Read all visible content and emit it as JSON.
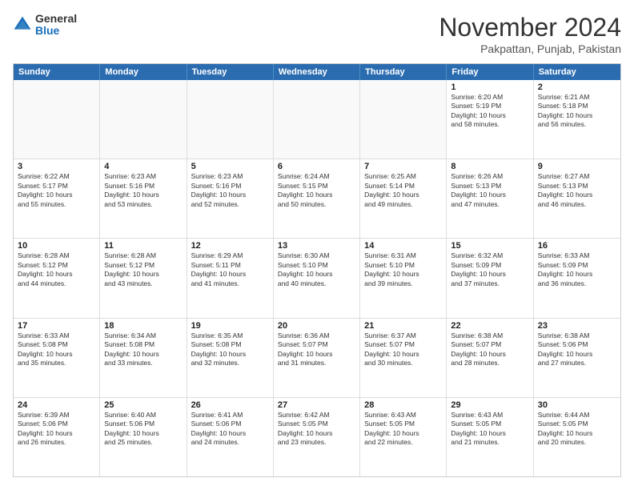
{
  "logo": {
    "general": "General",
    "blue": "Blue"
  },
  "title": "November 2024",
  "subtitle": "Pakpattan, Punjab, Pakistan",
  "days": [
    "Sunday",
    "Monday",
    "Tuesday",
    "Wednesday",
    "Thursday",
    "Friday",
    "Saturday"
  ],
  "weeks": [
    [
      {
        "day": "",
        "content": ""
      },
      {
        "day": "",
        "content": ""
      },
      {
        "day": "",
        "content": ""
      },
      {
        "day": "",
        "content": ""
      },
      {
        "day": "",
        "content": ""
      },
      {
        "day": "1",
        "content": "Sunrise: 6:20 AM\nSunset: 5:19 PM\nDaylight: 10 hours\nand 58 minutes."
      },
      {
        "day": "2",
        "content": "Sunrise: 6:21 AM\nSunset: 5:18 PM\nDaylight: 10 hours\nand 56 minutes."
      }
    ],
    [
      {
        "day": "3",
        "content": "Sunrise: 6:22 AM\nSunset: 5:17 PM\nDaylight: 10 hours\nand 55 minutes."
      },
      {
        "day": "4",
        "content": "Sunrise: 6:23 AM\nSunset: 5:16 PM\nDaylight: 10 hours\nand 53 minutes."
      },
      {
        "day": "5",
        "content": "Sunrise: 6:23 AM\nSunset: 5:16 PM\nDaylight: 10 hours\nand 52 minutes."
      },
      {
        "day": "6",
        "content": "Sunrise: 6:24 AM\nSunset: 5:15 PM\nDaylight: 10 hours\nand 50 minutes."
      },
      {
        "day": "7",
        "content": "Sunrise: 6:25 AM\nSunset: 5:14 PM\nDaylight: 10 hours\nand 49 minutes."
      },
      {
        "day": "8",
        "content": "Sunrise: 6:26 AM\nSunset: 5:13 PM\nDaylight: 10 hours\nand 47 minutes."
      },
      {
        "day": "9",
        "content": "Sunrise: 6:27 AM\nSunset: 5:13 PM\nDaylight: 10 hours\nand 46 minutes."
      }
    ],
    [
      {
        "day": "10",
        "content": "Sunrise: 6:28 AM\nSunset: 5:12 PM\nDaylight: 10 hours\nand 44 minutes."
      },
      {
        "day": "11",
        "content": "Sunrise: 6:28 AM\nSunset: 5:12 PM\nDaylight: 10 hours\nand 43 minutes."
      },
      {
        "day": "12",
        "content": "Sunrise: 6:29 AM\nSunset: 5:11 PM\nDaylight: 10 hours\nand 41 minutes."
      },
      {
        "day": "13",
        "content": "Sunrise: 6:30 AM\nSunset: 5:10 PM\nDaylight: 10 hours\nand 40 minutes."
      },
      {
        "day": "14",
        "content": "Sunrise: 6:31 AM\nSunset: 5:10 PM\nDaylight: 10 hours\nand 39 minutes."
      },
      {
        "day": "15",
        "content": "Sunrise: 6:32 AM\nSunset: 5:09 PM\nDaylight: 10 hours\nand 37 minutes."
      },
      {
        "day": "16",
        "content": "Sunrise: 6:33 AM\nSunset: 5:09 PM\nDaylight: 10 hours\nand 36 minutes."
      }
    ],
    [
      {
        "day": "17",
        "content": "Sunrise: 6:33 AM\nSunset: 5:08 PM\nDaylight: 10 hours\nand 35 minutes."
      },
      {
        "day": "18",
        "content": "Sunrise: 6:34 AM\nSunset: 5:08 PM\nDaylight: 10 hours\nand 33 minutes."
      },
      {
        "day": "19",
        "content": "Sunrise: 6:35 AM\nSunset: 5:08 PM\nDaylight: 10 hours\nand 32 minutes."
      },
      {
        "day": "20",
        "content": "Sunrise: 6:36 AM\nSunset: 5:07 PM\nDaylight: 10 hours\nand 31 minutes."
      },
      {
        "day": "21",
        "content": "Sunrise: 6:37 AM\nSunset: 5:07 PM\nDaylight: 10 hours\nand 30 minutes."
      },
      {
        "day": "22",
        "content": "Sunrise: 6:38 AM\nSunset: 5:07 PM\nDaylight: 10 hours\nand 28 minutes."
      },
      {
        "day": "23",
        "content": "Sunrise: 6:38 AM\nSunset: 5:06 PM\nDaylight: 10 hours\nand 27 minutes."
      }
    ],
    [
      {
        "day": "24",
        "content": "Sunrise: 6:39 AM\nSunset: 5:06 PM\nDaylight: 10 hours\nand 26 minutes."
      },
      {
        "day": "25",
        "content": "Sunrise: 6:40 AM\nSunset: 5:06 PM\nDaylight: 10 hours\nand 25 minutes."
      },
      {
        "day": "26",
        "content": "Sunrise: 6:41 AM\nSunset: 5:06 PM\nDaylight: 10 hours\nand 24 minutes."
      },
      {
        "day": "27",
        "content": "Sunrise: 6:42 AM\nSunset: 5:05 PM\nDaylight: 10 hours\nand 23 minutes."
      },
      {
        "day": "28",
        "content": "Sunrise: 6:43 AM\nSunset: 5:05 PM\nDaylight: 10 hours\nand 22 minutes."
      },
      {
        "day": "29",
        "content": "Sunrise: 6:43 AM\nSunset: 5:05 PM\nDaylight: 10 hours\nand 21 minutes."
      },
      {
        "day": "30",
        "content": "Sunrise: 6:44 AM\nSunset: 5:05 PM\nDaylight: 10 hours\nand 20 minutes."
      }
    ]
  ]
}
